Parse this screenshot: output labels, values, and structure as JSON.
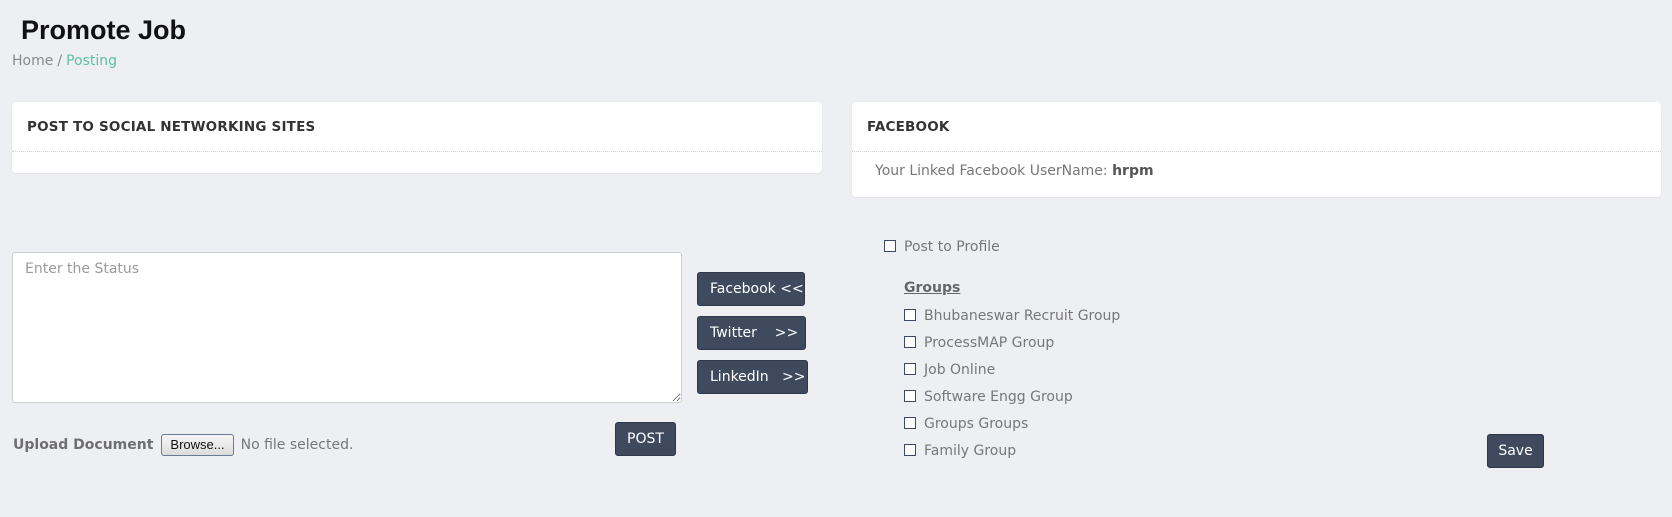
{
  "page": {
    "title": "Promote Job",
    "breadcrumb": {
      "home": "Home",
      "separator": "/",
      "current": "Posting"
    }
  },
  "social_panel": {
    "heading": "POST TO SOCIAL NETWORKING SITES"
  },
  "facebook_panel": {
    "heading": "FACEBOOK",
    "linked_label": "Your Linked Facebook UserName:",
    "username": "hrpm"
  },
  "status": {
    "placeholder": "Enter the Status",
    "value": ""
  },
  "network_buttons": {
    "facebook": "Facebook <<",
    "twitter": "Twitter    >>",
    "linkedin": "LinkedIn   >>"
  },
  "upload": {
    "label": "Upload Document",
    "browse": "Browse...",
    "status": "No file selected."
  },
  "post_button": "POST",
  "options": {
    "post_to_profile": "Post to Profile",
    "groups_heading": "Groups",
    "groups": [
      "Bhubaneswar Recruit Group",
      "ProcessMAP Group",
      "Job Online",
      "Software Engg Group",
      "Groups Groups",
      "Family Group"
    ]
  },
  "save_button": "Save",
  "colors": {
    "background": "#eeeff3",
    "button": "#3f4a5e",
    "breadcrumb_active": "#5fbfa2"
  }
}
